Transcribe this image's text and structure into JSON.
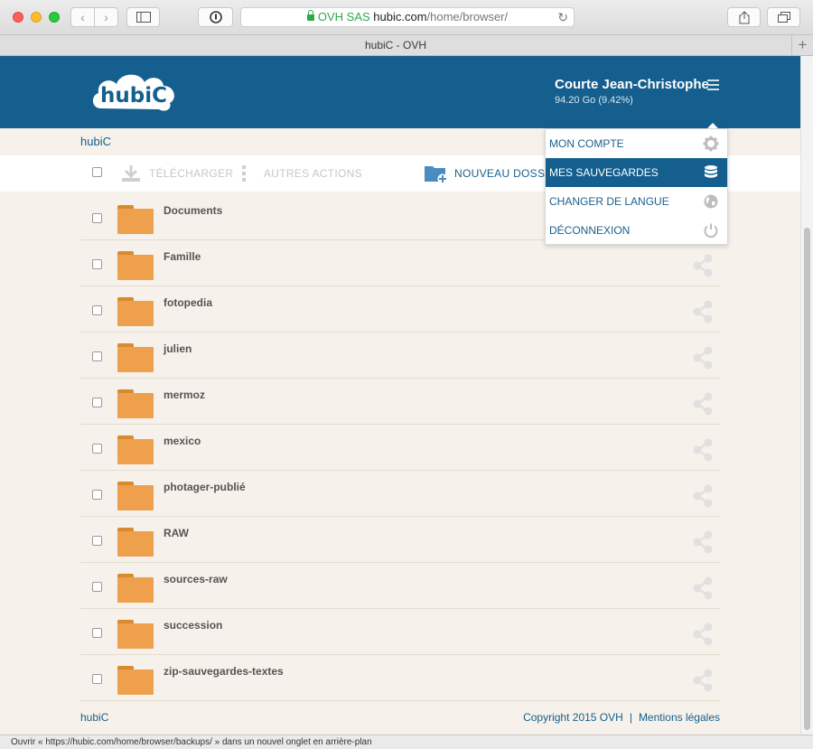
{
  "browser": {
    "url_company": "OVH SAS",
    "url_host": "hubic.com",
    "url_path": "/home/browser/",
    "tab_title": "hubiC - OVH",
    "status_text": "Ouvrir « https://hubic.com/home/browser/backups/ » dans un nouvel onglet en arrière-plan"
  },
  "header": {
    "logo_text": "hubiC",
    "user_name": "Courte Jean-Christophe",
    "quota": "94.20 Go (9.42%)"
  },
  "breadcrumb": "hubiC",
  "actions": {
    "download": "TÉLÉCHARGER",
    "other": "AUTRES ACTIONS",
    "new_folder": "NOUVEAU DOSSIER"
  },
  "folders": [
    "Documents",
    "Famille",
    "fotopedia",
    "julien",
    "mermoz",
    "mexico",
    "photager-publié",
    "RAW",
    "sources-raw",
    "succession",
    "zip-sauvegardes-textes"
  ],
  "menu": {
    "items": [
      {
        "label": "MON COMPTE",
        "icon": "gear-icon"
      },
      {
        "label": "MES SAUVEGARDES",
        "icon": "database-icon",
        "active": true
      },
      {
        "label": "CHANGER DE LANGUE",
        "icon": "globe-icon"
      },
      {
        "label": "DÉCONNEXION",
        "icon": "power-icon"
      }
    ]
  },
  "footer": {
    "left": "hubiC",
    "copyright": "Copyright 2015 OVH",
    "separator": "|",
    "legal": "Mentions légales"
  },
  "colors": {
    "brand_blue": "#145f8e",
    "folder_orange": "#eea04d",
    "page_bg": "#f6f1ea"
  }
}
